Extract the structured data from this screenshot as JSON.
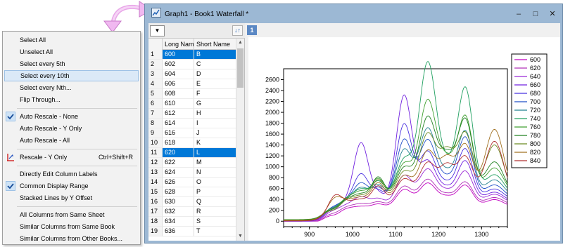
{
  "menu": {
    "items": [
      {
        "label": "Select All"
      },
      {
        "label": "Unselect All"
      },
      {
        "label": "Select every 5th"
      },
      {
        "label": "Select every 10th",
        "highlighted": true
      },
      {
        "label": "Select every Nth..."
      },
      {
        "label": "Flip Through..."
      },
      {
        "separator": true
      },
      {
        "label": "Auto Rescale - None",
        "checked": true
      },
      {
        "label": "Auto Rescale - Y Only"
      },
      {
        "label": "Auto Rescale - All"
      },
      {
        "separator": true
      },
      {
        "label": "Rescale - Y Only",
        "shortcut": "Ctrl+Shift+R",
        "icon": "rescale-icon"
      },
      {
        "separator": true
      },
      {
        "label": "Directly Edit Column Labels"
      },
      {
        "label": "Common Display Range",
        "checked": true
      },
      {
        "label": "Stacked Lines by Y Offset"
      },
      {
        "separator": true
      },
      {
        "label": "All Columns from Same Sheet"
      },
      {
        "label": "Similar Columns from Same Book"
      },
      {
        "label": "Similar Columns from Other Books..."
      }
    ]
  },
  "window": {
    "title": "Graph1 - Book1 Waterfall *",
    "icon": "graph-window-icon",
    "controls": {
      "minimize": "–",
      "maximize": "□",
      "close": "✕"
    }
  },
  "toolbar": {
    "dropdown_icon": "▼",
    "sort_icon": "↓↑"
  },
  "column_list": {
    "headers": [
      "",
      "Long Name",
      "Short Name"
    ],
    "rows": [
      {
        "idx": "1",
        "long": "600",
        "short": "B",
        "selected": true
      },
      {
        "idx": "2",
        "long": "602",
        "short": "C"
      },
      {
        "idx": "3",
        "long": "604",
        "short": "D"
      },
      {
        "idx": "4",
        "long": "606",
        "short": "E"
      },
      {
        "idx": "5",
        "long": "608",
        "short": "F"
      },
      {
        "idx": "6",
        "long": "610",
        "short": "G"
      },
      {
        "idx": "7",
        "long": "612",
        "short": "H"
      },
      {
        "idx": "8",
        "long": "614",
        "short": "I"
      },
      {
        "idx": "9",
        "long": "616",
        "short": "J"
      },
      {
        "idx": "10",
        "long": "618",
        "short": "K"
      },
      {
        "idx": "11",
        "long": "620",
        "short": "L",
        "selected": true
      },
      {
        "idx": "12",
        "long": "622",
        "short": "M"
      },
      {
        "idx": "13",
        "long": "624",
        "short": "N"
      },
      {
        "idx": "14",
        "long": "626",
        "short": "O"
      },
      {
        "idx": "15",
        "long": "628",
        "short": "P"
      },
      {
        "idx": "16",
        "long": "630",
        "short": "Q"
      },
      {
        "idx": "17",
        "long": "632",
        "short": "R"
      },
      {
        "idx": "18",
        "long": "634",
        "short": "S"
      },
      {
        "idx": "19",
        "long": "636",
        "short": "T"
      }
    ]
  },
  "layer_tab": "1",
  "chart_data": {
    "type": "line",
    "title": "",
    "xlabel": "",
    "ylabel": "",
    "xlim": [
      840,
      1360
    ],
    "ylim": [
      -100,
      2800
    ],
    "xticks": [
      900,
      1000,
      1100,
      1200,
      1300
    ],
    "yticks": [
      0,
      200,
      400,
      600,
      800,
      1000,
      1200,
      1400,
      1600,
      1800,
      2000,
      2200,
      2400,
      2600
    ],
    "grid": false,
    "legend_position": "right",
    "peak_centers": [
      960,
      1020,
      1060,
      1120,
      1175,
      1220,
      1262,
      1330
    ],
    "peak_widths": [
      14,
      17,
      14,
      18,
      20,
      17,
      18,
      22
    ],
    "series": [
      {
        "name": "600",
        "color": "#c000c0",
        "peaks": [
          60,
          180,
          220,
          480,
          600,
          320,
          560,
          300
        ],
        "baseline": 280,
        "offset": -30
      },
      {
        "name": "620",
        "color": "#b030b8",
        "peaks": [
          80,
          210,
          240,
          520,
          650,
          340,
          600,
          320
        ],
        "baseline": 300,
        "offset": -20
      },
      {
        "name": "640",
        "color": "#9a28d6",
        "peaks": [
          120,
          320,
          280,
          700,
          820,
          380,
          780,
          360
        ],
        "baseline": 320,
        "offset": -10
      },
      {
        "name": "660",
        "color": "#7020e0",
        "peaks": [
          140,
          1290,
          340,
          2150,
          950,
          400,
          950,
          380
        ],
        "baseline": 340,
        "offset": 0
      },
      {
        "name": "680",
        "color": "#4830e0",
        "peaks": [
          160,
          700,
          380,
          1600,
          1100,
          450,
          1150,
          420
        ],
        "baseline": 360,
        "offset": 10
      },
      {
        "name": "700",
        "color": "#2050c8",
        "peaks": [
          150,
          520,
          420,
          1300,
          1300,
          520,
          1350,
          480
        ],
        "baseline": 380,
        "offset": 15
      },
      {
        "name": "720",
        "color": "#208090",
        "peaks": [
          120,
          420,
          460,
          1100,
          1500,
          600,
          1450,
          560
        ],
        "baseline": 400,
        "offset": 20
      },
      {
        "name": "740",
        "color": "#20a060",
        "peaks": [
          100,
          380,
          520,
          900,
          2700,
          700,
          2230,
          640
        ],
        "baseline": 420,
        "offset": 25
      },
      {
        "name": "760",
        "color": "#40a030",
        "peaks": [
          90,
          340,
          560,
          820,
          2000,
          800,
          1700,
          760
        ],
        "baseline": 420,
        "offset": 30
      },
      {
        "name": "780",
        "color": "#208020",
        "peaks": [
          80,
          300,
          600,
          760,
          1700,
          900,
          1650,
          880
        ],
        "baseline": 410,
        "offset": 25
      },
      {
        "name": "800",
        "color": "#6a8a20",
        "peaks": [
          70,
          280,
          560,
          700,
          1400,
          1000,
          1400,
          1200
        ],
        "baseline": 400,
        "offset": 20
      },
      {
        "name": "820",
        "color": "#a07020",
        "peaks": [
          300,
          260,
          520,
          640,
          1100,
          900,
          1200,
          1500
        ],
        "baseline": 380,
        "offset": 15
      },
      {
        "name": "840",
        "color": "#b03030",
        "peaks": [
          360,
          240,
          480,
          600,
          900,
          800,
          1000,
          1300
        ],
        "baseline": 360,
        "offset": 5
      }
    ]
  }
}
